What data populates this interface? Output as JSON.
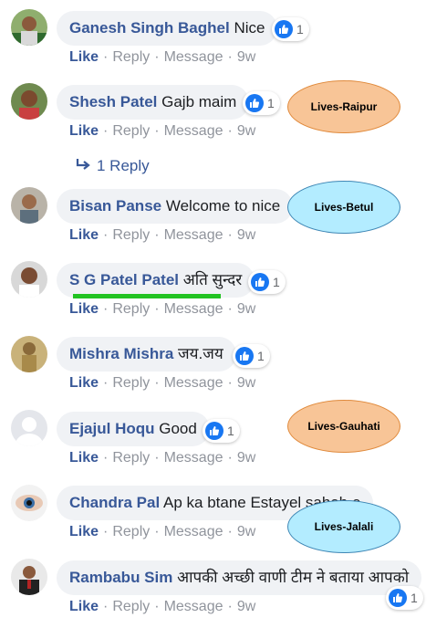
{
  "comments": [
    {
      "name": "Ganesh Singh Baghel",
      "text": "Nice",
      "reactions": "1",
      "actions": {
        "like": "Like",
        "reply": "Reply",
        "message": "Message",
        "time": "9w"
      }
    },
    {
      "name": "Shesh Patel",
      "text": "Gajb maim",
      "reactions": "1",
      "actions": {
        "like": "Like",
        "reply": "Reply",
        "message": "Message",
        "time": "9w"
      }
    },
    {
      "name": "Bisan Panse",
      "text": "Welcome to nice",
      "reactions": "",
      "actions": {
        "like": "Like",
        "reply": "Reply",
        "message": "Message",
        "time": "9w"
      }
    },
    {
      "name": "S G Patel Patel",
      "text": "अति सुन्दर",
      "reactions": "1",
      "actions": {
        "like": "Like",
        "reply": "Reply",
        "message": "Message",
        "time": "9w"
      }
    },
    {
      "name": "Mishra Mishra",
      "text": "जय.जय",
      "reactions": "1",
      "actions": {
        "like": "Like",
        "reply": "Reply",
        "message": "Message",
        "time": "9w"
      }
    },
    {
      "name": "Ejajul Hoqu",
      "text": "Good",
      "reactions": "1",
      "actions": {
        "like": "Like",
        "reply": "Reply",
        "message": "Message",
        "time": "9w"
      }
    },
    {
      "name": "Chandra Pal",
      "text": "Ap ka btane Estayel sahab e",
      "reactions": "",
      "actions": {
        "like": "Like",
        "reply": "Reply",
        "message": "Message",
        "time": "9w"
      }
    },
    {
      "name": "Rambabu Sim",
      "text": "आपकी अच्छी वाणी टीम ने बताया आपको",
      "reactions": "1",
      "actions": {
        "like": "Like",
        "reply": "Reply",
        "message": "Message",
        "time": "9w"
      }
    }
  ],
  "replies_link": "1 Reply",
  "annotations": {
    "raipur": "Lives-Raipur",
    "betul": "Lives-Betul",
    "gauhati": "Lives-Gauhati",
    "jalali": "Lives-Jalali"
  },
  "colors": {
    "name": "#385898",
    "bubble": "#f0f2f5",
    "meta": "#90949c",
    "like_blue": "#1877f2",
    "orange_oval": "#f8c597",
    "blue_oval": "#b3ecff",
    "underline": "#22c322"
  },
  "icons": [
    "like-thumb-icon",
    "reply-arrow-icon"
  ]
}
